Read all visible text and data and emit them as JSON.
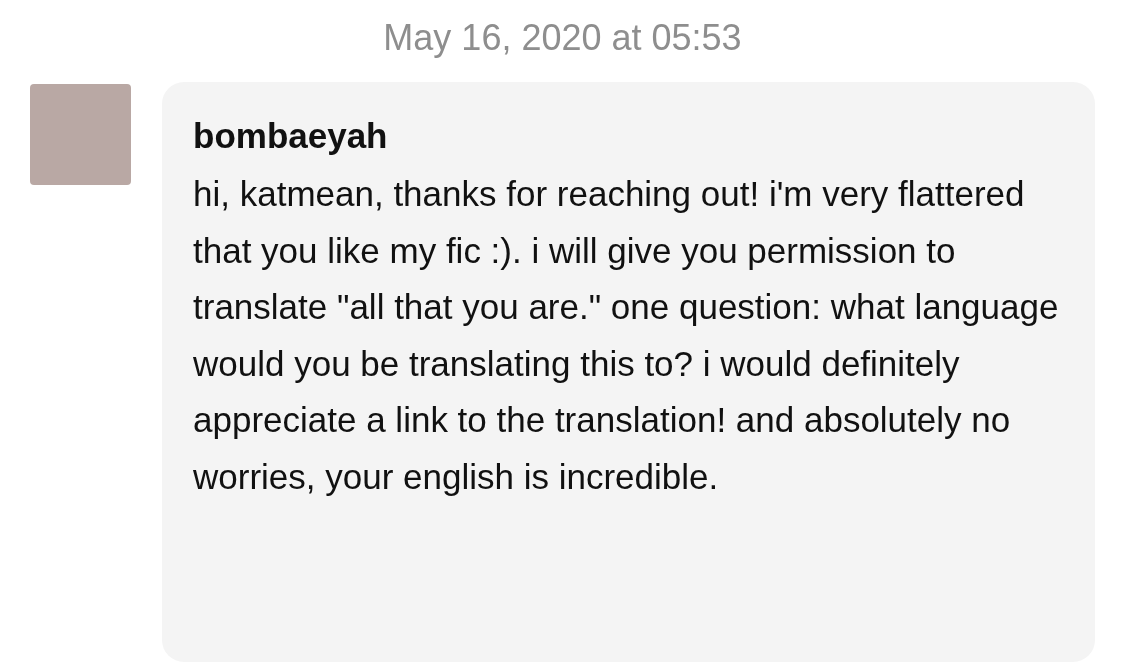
{
  "timestamp": "May 16, 2020 at 05:53",
  "message": {
    "sender": "bombaeyah",
    "text": "hi, katmean, thanks for reaching out! i'm very flattered that you like my fic :). i will give you permission to translate \"all that you are.\" one question: what language would you be translating this to? i would definitely appreciate a link to the translation! and absolutely no worries, your english is incredible."
  }
}
